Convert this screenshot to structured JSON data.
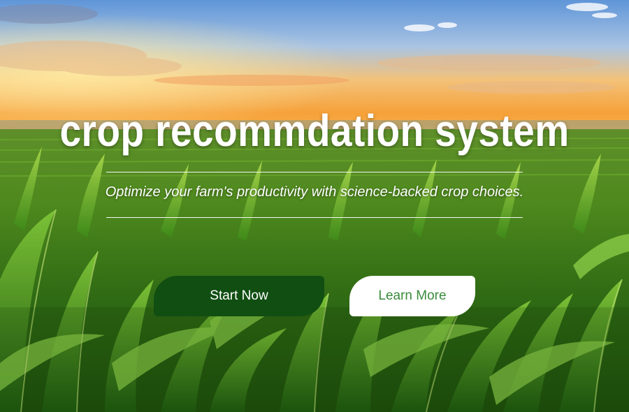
{
  "hero": {
    "title": "crop recommdation system",
    "tagline": "Optimize your farm's productivity with science-backed crop choices."
  },
  "buttons": {
    "start_label": "Start Now",
    "learn_label": "Learn More"
  },
  "colors": {
    "start_button_bg": "#104e12",
    "learn_button_text": "#3a8a3c",
    "title_text": "#ffffff"
  }
}
